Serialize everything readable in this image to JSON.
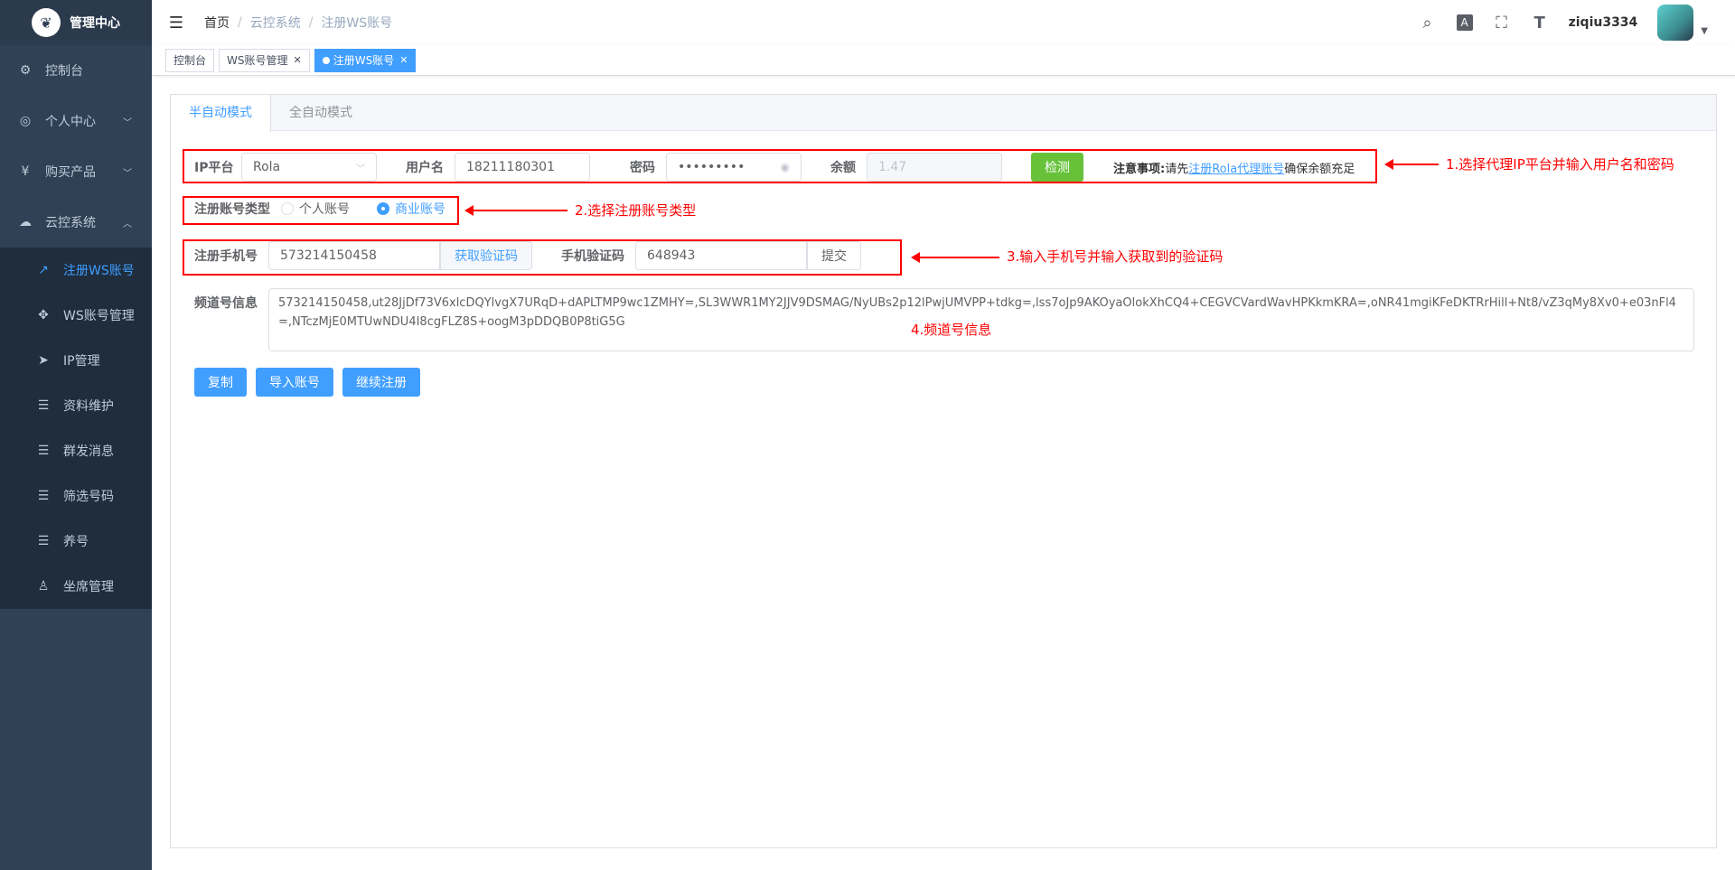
{
  "app": {
    "title": "管理中心",
    "logo_glyph": "❦"
  },
  "sidebar": {
    "items": [
      {
        "label": "控制台",
        "icon": "dashboard-icon",
        "glyph": "⚙"
      },
      {
        "label": "个人中心",
        "icon": "user-center-icon",
        "glyph": "◎"
      },
      {
        "label": "购买产品",
        "icon": "yen-icon",
        "glyph": "¥"
      },
      {
        "label": "云控系统",
        "icon": "cloud-icon",
        "glyph": "☁"
      }
    ],
    "submenu": [
      {
        "label": "注册WS账号",
        "icon": "external-link-icon",
        "glyph": "↗"
      },
      {
        "label": "WS账号管理",
        "icon": "move-icon",
        "glyph": "✥"
      },
      {
        "label": "IP管理",
        "icon": "send-icon",
        "glyph": "➤"
      },
      {
        "label": "资料维护",
        "icon": "list-icon",
        "glyph": "☰"
      },
      {
        "label": "群发消息",
        "icon": "list-icon",
        "glyph": "☰"
      },
      {
        "label": "筛选号码",
        "icon": "list-icon",
        "glyph": "☰"
      },
      {
        "label": "养号",
        "icon": "list-icon",
        "glyph": "☰"
      },
      {
        "label": "坐席管理",
        "icon": "person-icon",
        "glyph": "♙"
      }
    ]
  },
  "navbar": {
    "breadcrumb": [
      "首页",
      "云控系统",
      "注册WS账号"
    ],
    "username": "ziqiu3334",
    "icons": {
      "search": "⌕",
      "translate": "A",
      "fullscreen": "⛶",
      "fontsize": "T"
    }
  },
  "tags": [
    {
      "label": "控制台"
    },
    {
      "label": "WS账号管理"
    },
    {
      "label": "注册WS账号"
    }
  ],
  "tabs": [
    "半自动模式",
    "全自动模式"
  ],
  "form": {
    "ip_platform_label": "IP平台",
    "ip_platform_value": "Rola",
    "username_label": "用户名",
    "username_value": "18211180301",
    "password_label": "密码",
    "password_value": "•••••••••",
    "balance_label": "余额",
    "balance_value": "1.47",
    "check_button": "检测",
    "note_title": "注意事项:",
    "note_prefix": "请先",
    "note_link": "注册Rola代理账号",
    "note_suffix": "确保余额充足",
    "account_type_label": "注册账号类型",
    "account_type_personal": "个人账号",
    "account_type_business": "商业账号",
    "phone_label": "注册手机号",
    "phone_value": "573214150458",
    "get_code_button": "获取验证码",
    "code_label": "手机验证码",
    "code_value": "648943",
    "submit_button": "提交",
    "channel_label": "频道号信息",
    "channel_value": "573214150458,ut28JjDf73V6xlcDQYlvgX7URqD+dAPLTMP9wc1ZMHY=,SL3WWR1MY2JJV9DSMAG/NyUBs2p12lPwjUMVPP+tdkg=,lss7oJp9AKOyaOlokXhCQ4+CEGVCVardWavHPKkmKRA=,oNR41mgiKFeDKTRrHill+Nt8/vZ3qMy8Xv0+e03nFl4=,NTczMjE0MTUwNDU4I8cgFLZ8S+oogM3pDDQB0P8tiG5G",
    "copy_button": "复制",
    "import_button": "导入账号",
    "continue_button": "继续注册"
  },
  "annotations": {
    "a1": "1.选择代理IP平台并输入用户名和密码",
    "a2": "2.选择注册账号类型",
    "a3": "3.输入手机号并输入获取到的验证码",
    "a4": "4.频道号信息"
  }
}
